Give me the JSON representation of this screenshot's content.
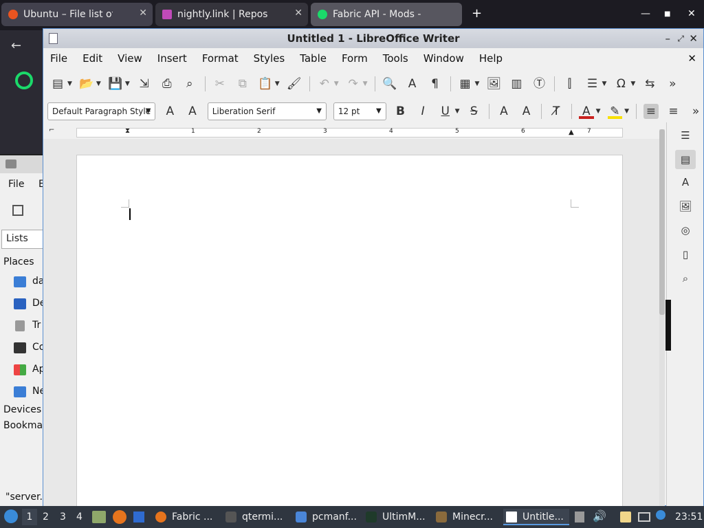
{
  "browser": {
    "tabs": [
      {
        "title": "Ubuntu – File list of pack",
        "active": false
      },
      {
        "title": "nightly.link | Repository A",
        "active": false
      },
      {
        "title": "Fabric API - Mods - Modri",
        "active": true
      }
    ],
    "new_tab": "+"
  },
  "file_manager": {
    "menu_file": "File",
    "menu_edit": "E",
    "lists_label": "Lists",
    "places_label": "Places",
    "places": [
      "da",
      "De",
      "Tr",
      "Co",
      "Ap",
      "Ne"
    ],
    "devices_label": "Devices",
    "bookmarks_label": "Bookma",
    "status": "\"server."
  },
  "writer": {
    "title": "Untitled 1 - LibreOffice Writer",
    "menu": [
      "File",
      "Edit",
      "View",
      "Insert",
      "Format",
      "Styles",
      "Table",
      "Form",
      "Tools",
      "Window",
      "Help"
    ],
    "paragraph_style": "Default Paragraph Style",
    "font_name": "Liberation Serif",
    "font_size": "12 pt",
    "ruler_numbers": [
      "1",
      "2",
      "3",
      "4",
      "5",
      "6",
      "7"
    ]
  },
  "taskbar": {
    "workspaces": [
      "1",
      "2",
      "3",
      "4"
    ],
    "tasks": [
      "Fabric ...",
      "qtermi...",
      "pcmanf...",
      "UltimM...",
      "Minecr...",
      "Untitle..."
    ],
    "clock": "23:51"
  }
}
